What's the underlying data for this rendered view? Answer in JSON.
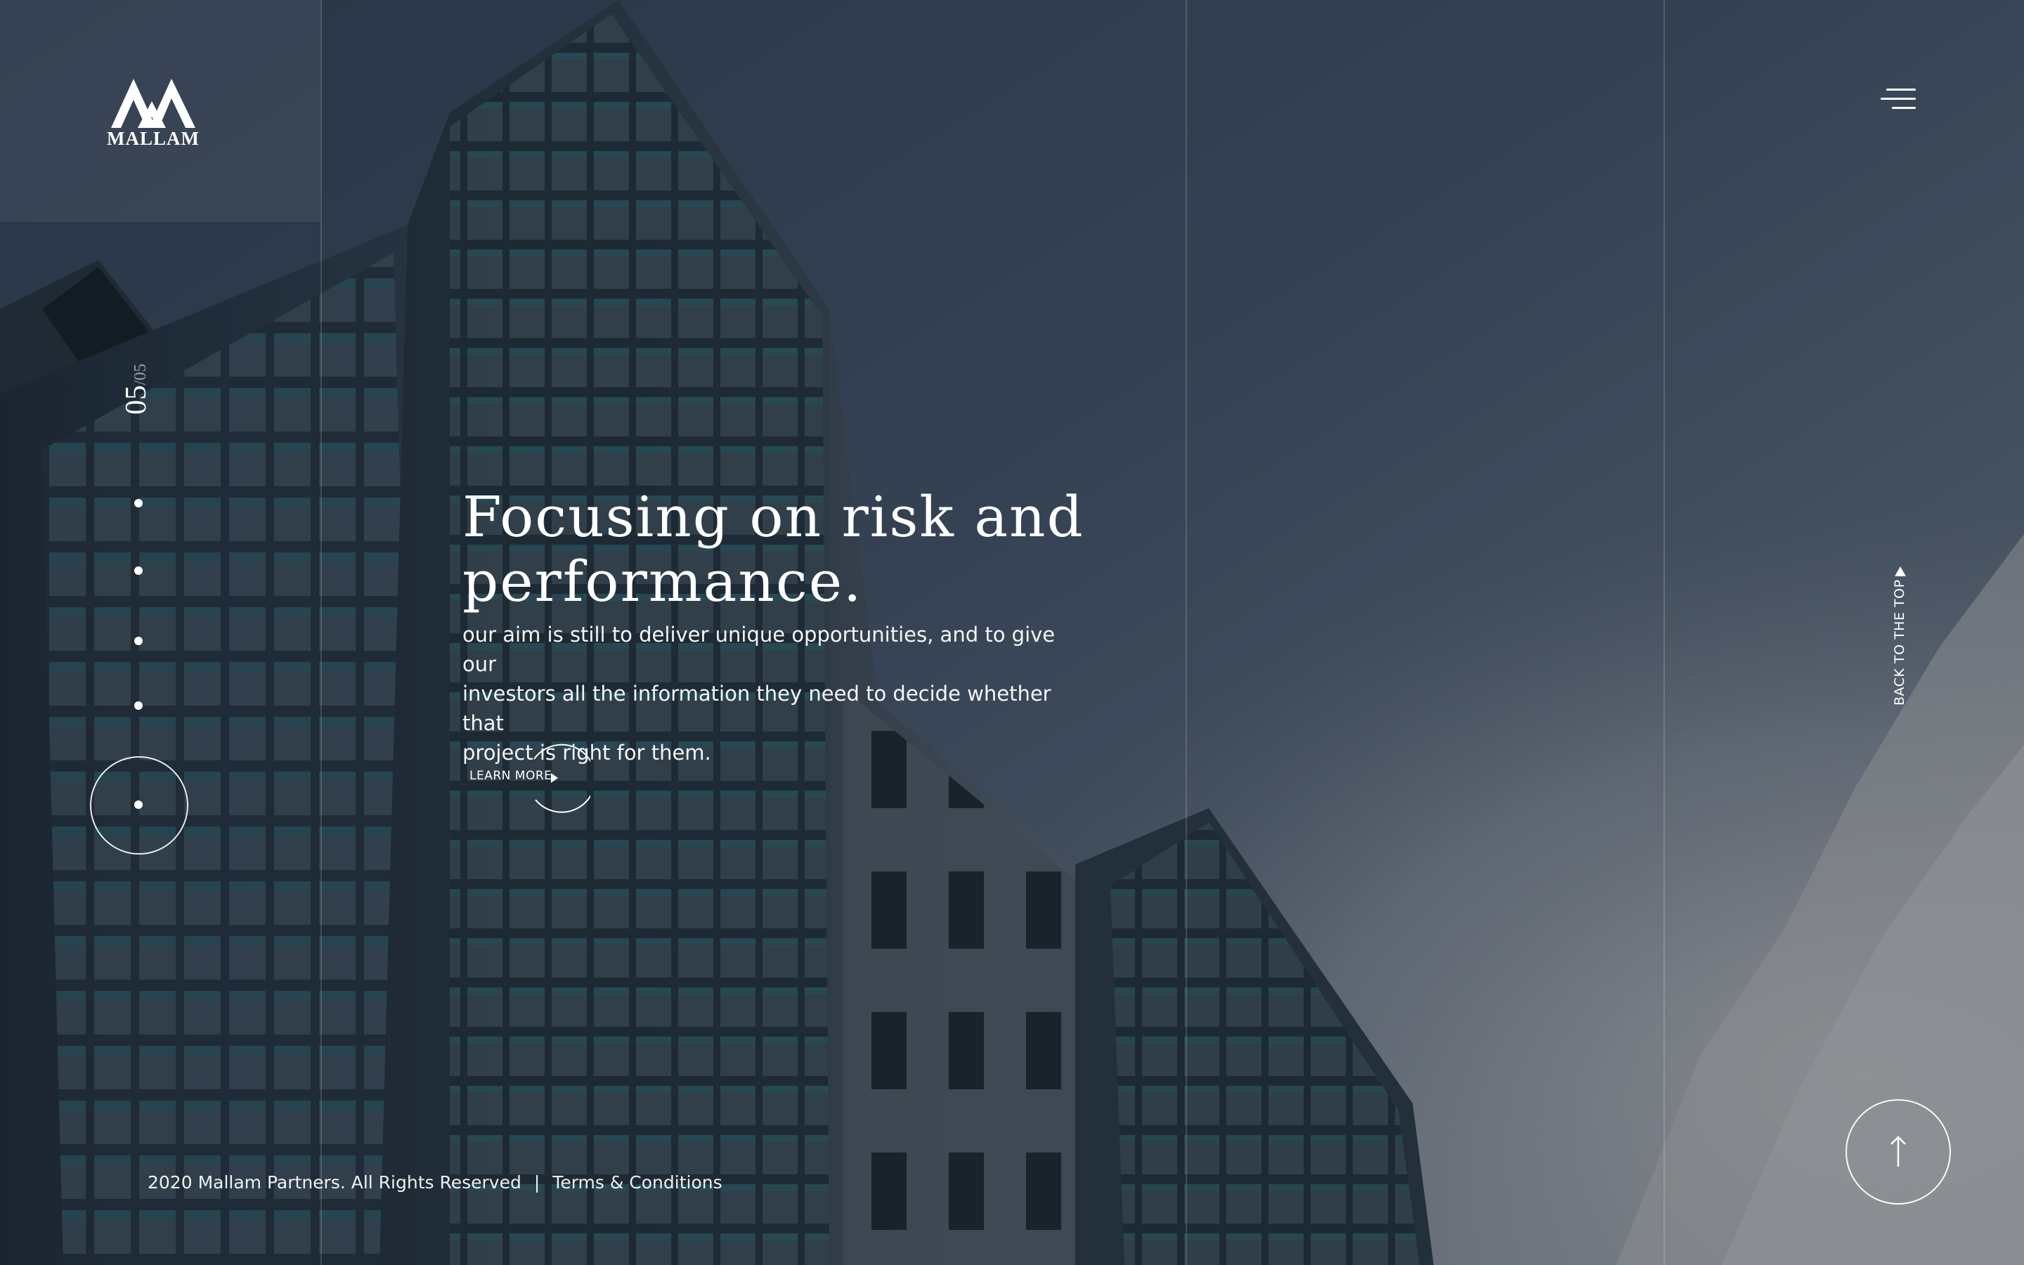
{
  "brand": {
    "name": "MALLAM",
    "logo_icon": "mallam-mountain-logo-icon"
  },
  "header": {
    "menu_icon": "hamburger-menu-icon"
  },
  "slider": {
    "current": "05",
    "total": "/05",
    "slide_count": 5,
    "active_index": 5
  },
  "hero": {
    "title_line1": "Focusing on risk and",
    "title_line2": "performance.",
    "text_line1": "our aim is still to deliver unique opportunities, and to give our",
    "text_line2": "investors all the information they need to decide whether that",
    "text_line3": "project is right for them.",
    "cta_label": "LEARN MORE",
    "cta_icon": "play-triangle-icon"
  },
  "back_to_top": {
    "label": "BACK TO THE TOP",
    "icon": "triangle-up-icon",
    "circle_icon": "arrow-up-icon"
  },
  "footer": {
    "copyright": "2020 Mallam Partners. All Rights Reserved",
    "separator": "|",
    "terms": "Terms & Conditions"
  },
  "colors": {
    "text": "#ffffff",
    "sky": "#3b4a5c",
    "building": "#1e2a36",
    "accent_glass": "#2f5a62"
  }
}
